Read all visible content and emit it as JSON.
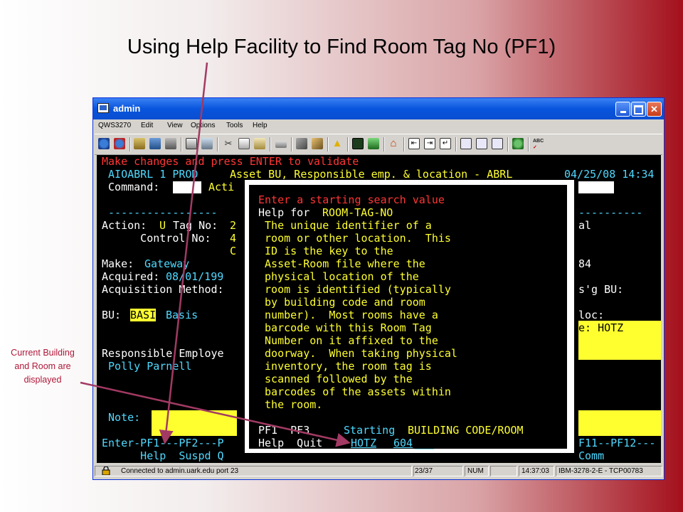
{
  "slide": {
    "title": "Using Help Facility to Find Room Tag No (PF1)",
    "callout": "Current Building and Room are displayed",
    "arrow_color": "#a23a63"
  },
  "window": {
    "title": "admin",
    "menu": [
      "QWS3270",
      "Edit",
      "View",
      "Options",
      "Tools",
      "Help"
    ],
    "title_buttons": [
      "minimize",
      "maximize",
      "close"
    ]
  },
  "toolbar_icons": [
    "connect-icon",
    "disconnect-icon",
    "macro-icon",
    "screen-icon",
    "print-icon",
    "copy-screen-icon",
    "paste-icon",
    "cut-icon",
    "copy-icon",
    "paste-icon-2",
    "keyboard-icon",
    "tools-icon",
    "edit-icon",
    "alert-icon",
    "receive-icon",
    "send-icon",
    "home-icon",
    "tab-back-icon",
    "tab-icon",
    "enter-icon",
    "pf1-icon",
    "pf2-icon",
    "pf3-icon",
    "leaf-icon",
    "spellcheck-icon"
  ],
  "terminal": {
    "bg": "#000000",
    "colors": {
      "red": "#ff3535",
      "cyan": "#4fd9ff",
      "yellow": "#ffff30",
      "white": "#ffffff"
    },
    "lines": {
      "l1": "Make changes and press ENTER to validate",
      "l2a": " AIOABRL 1 PROD",
      "l2b": "Asset BU, Responsible emp. & location - ABRL",
      "l2c": "04/25/08 14:34",
      "l3a": " Command:",
      "l3b": "Acti",
      "l4a": " -----------------",
      "l4b": "----------",
      "l5a": "Action:",
      "l5b": "U",
      "l5c": "Tag No:",
      "l5d": "2",
      "l5e": "al",
      "l6a": "      Control No:",
      "l6b": "4",
      "l6e": "84",
      "l7a": "C",
      "l8a": "Make:",
      "l8b": "Gateway",
      "l8e": "84",
      "l9a": "Acquired:",
      "l9b": "08/01/199",
      "l10a": "Acquisition Method:",
      "l10e": "s'g BU:",
      "l12a": "BU:",
      "l12b": "BASI",
      "l12c": "Basis",
      "l12e": "loc:",
      "l13e": "e: HOTZ",
      "l15a": "Responsible Employe",
      "l16a": " Polly Parnell",
      "l19a": " Note:",
      "l21a": "Enter-PF1---PF2---P",
      "l21e": "F11--PF12---",
      "l22a": "      Help  Suspd Q",
      "l22e": "Comm"
    },
    "popup": {
      "heading": "Enter a starting search value",
      "help_for_label": "Help for",
      "help_for_field": "ROOM-TAG-NO",
      "description": [
        " The unique identifier of a",
        " room or other location.  This",
        " ID is the key to the",
        " Asset-Room file where the",
        " physical location of the",
        " room is identified (typically",
        " by building code and room",
        " number).  Most rooms have a",
        " barcode with this Room Tag",
        " Number on it affixed to the",
        " doorway.  When taking physical",
        " inventory, the room tag is",
        " scanned followed by the",
        " barcodes of the assets within",
        " the room."
      ],
      "pf_keys": "PF1  PF3",
      "starting_label": "Starting",
      "starting_field": "BUILDING CODE/ROOM",
      "pf_labels": "Help  Quit",
      "building_value": "HOTZ",
      "room_value": "604"
    }
  },
  "statusbar": {
    "connection": "Connected to admin.uark.edu port 23",
    "position": "23/37",
    "num": "NUM",
    "time": "14:37:03",
    "terminal_type": "IBM-3278-2-E - TCP00783"
  }
}
